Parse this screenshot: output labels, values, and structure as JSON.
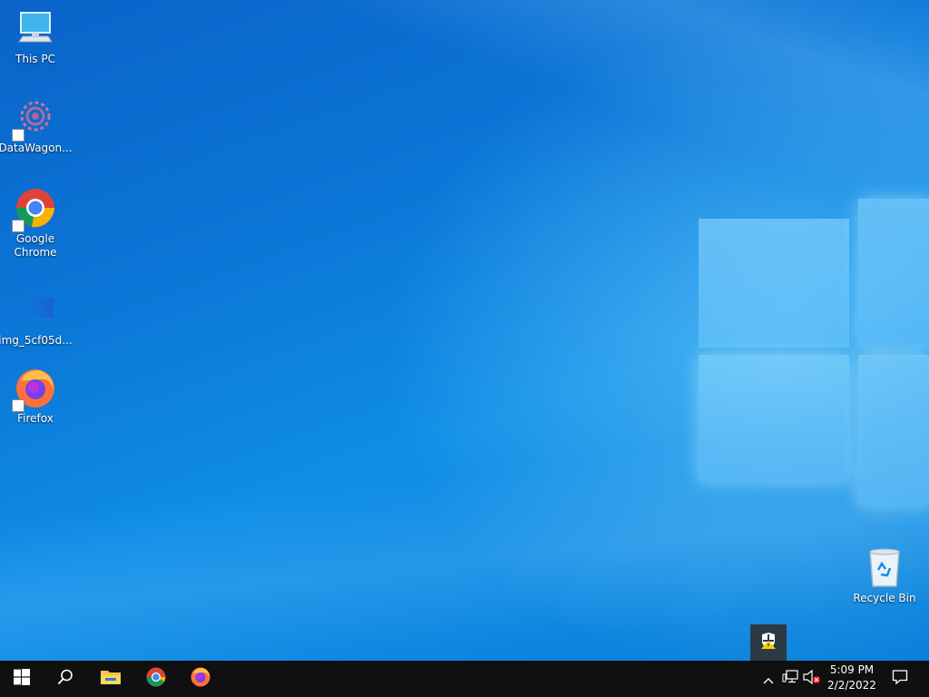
{
  "desktop_icons": [
    {
      "label": "This PC",
      "icon": "this-pc-icon"
    },
    {
      "label": "DataWagon...",
      "icon": "datawagon-icon"
    },
    {
      "label": "Google Chrome",
      "icon": "chrome-icon"
    },
    {
      "label": "img_5cf05d...",
      "icon": "image-file-icon"
    },
    {
      "label": "Firefox",
      "icon": "firefox-icon"
    },
    {
      "label": "Recycle Bin",
      "icon": "recycle-bin-icon"
    }
  ],
  "taskbar": {
    "start": "windows-start-icon",
    "search": "search-icon",
    "pinned": [
      "file-explorer-icon",
      "chrome-icon",
      "firefox-icon"
    ],
    "tray": {
      "overflow": "chevron-up-icon",
      "network": "network-icon",
      "volume": "volume-muted-icon",
      "notifications": "action-center-icon"
    },
    "clock": {
      "time": "5:09 PM",
      "date": "2/2/2022"
    }
  },
  "flyout": {
    "icon": "windows-security-warning-icon"
  }
}
